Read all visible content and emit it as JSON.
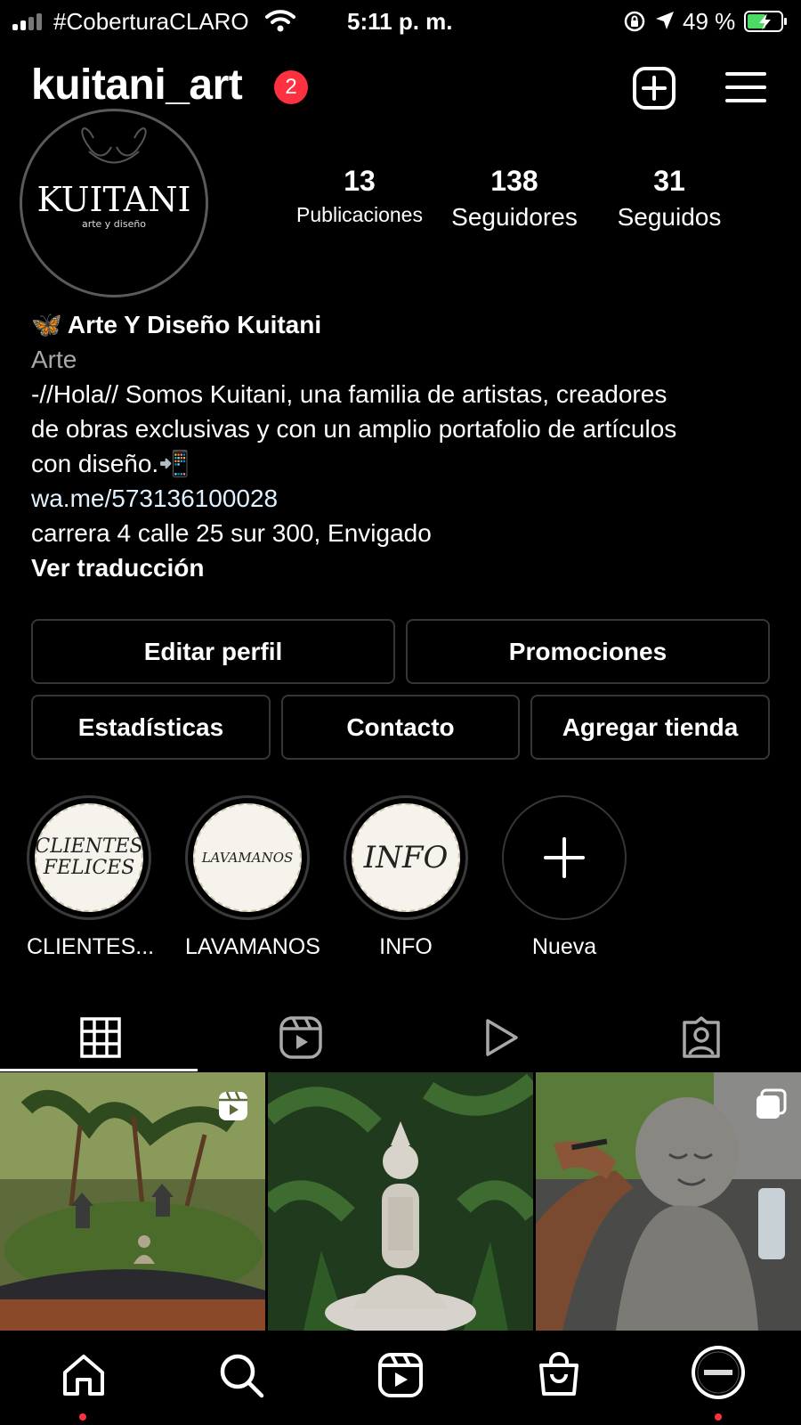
{
  "status_bar": {
    "carrier": "#CoberturaCLARO",
    "time": "5:11 p. m.",
    "battery": "49 %"
  },
  "header": {
    "username": "kuitani_art",
    "notification_count": "2"
  },
  "profile": {
    "avatar_title": "KUITANI",
    "avatar_subtitle": "arte y diseño",
    "stats": [
      {
        "value": "13",
        "label": "Publicaciones"
      },
      {
        "value": "138",
        "label": "Seguidores"
      },
      {
        "value": "31",
        "label": "Seguidos"
      }
    ],
    "name_emoji": "🦋",
    "name": "Arte Y Diseño Kuitani",
    "category": "Arte",
    "bio_line1": "-//Hola// Somos Kuitani, una familia de artistas, creadores",
    "bio_line2": "de obras exclusivas y con un amplio portafolio de artículos",
    "bio_line3": "con diseño.📲",
    "link": "wa.me/573136100028",
    "address": "carrera 4 calle 25 sur 300, Envigado",
    "translate": "Ver traducción"
  },
  "actions": {
    "edit_profile": "Editar perfil",
    "promotions": "Promociones",
    "insights": "Estadísticas",
    "contact": "Contacto",
    "add_shop": "Agregar tienda"
  },
  "highlights": [
    {
      "label": "CLIENTES...",
      "cover_l1": "CLIENTES",
      "cover_l2": "FELICES"
    },
    {
      "label": "LAVAMANOS",
      "cover_l1": "LAVAMANOS",
      "cover_l2": ""
    },
    {
      "label": "INFO",
      "cover_l1": "INFO",
      "cover_l2": ""
    },
    {
      "label": "Nueva"
    }
  ],
  "tabs": [
    "grid-icon",
    "reels-icon",
    "video-icon",
    "tagged-icon"
  ],
  "grid_posts": [
    {
      "description": "bonsai garden with buddha",
      "type": "reel"
    },
    {
      "description": "white buddha statue in plants",
      "type": "photo"
    },
    {
      "description": "painting a monk statue",
      "type": "carousel"
    }
  ],
  "bottom_nav": [
    "home-icon",
    "search-icon",
    "reels-icon",
    "shop-icon",
    "profile-avatar"
  ],
  "colors": {
    "background": "#000000",
    "badge": "#ff3040",
    "border": "#363636",
    "category_text": "#a8a8a8",
    "link_text": "#e0f1ff",
    "battery_fill": "#4cd964"
  }
}
